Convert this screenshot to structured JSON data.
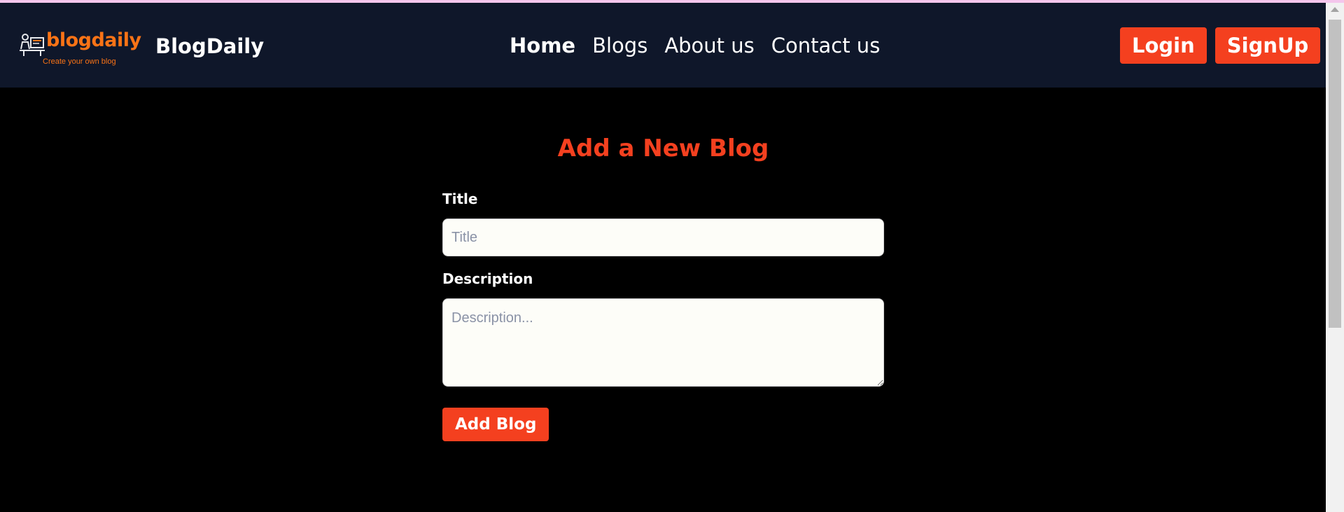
{
  "navbar": {
    "logo_word": "blogdaily",
    "logo_tagline": "Create your own blog",
    "brand": "BlogDaily",
    "links": [
      {
        "label": "Home"
      },
      {
        "label": "Blogs"
      },
      {
        "label": "About us"
      },
      {
        "label": "Contact us"
      }
    ],
    "login_label": "Login",
    "signup_label": "SignUp"
  },
  "form": {
    "heading": "Add a New Blog",
    "title_label": "Title",
    "title_value": "",
    "title_placeholder": "Title",
    "description_label": "Description",
    "description_value": "",
    "description_placeholder": "Description...",
    "submit_label": "Add Blog"
  },
  "colors": {
    "navbar_bg": "#0f172a",
    "accent": "#f4401f",
    "logo_orange": "#f97316",
    "page_bg": "#000000"
  },
  "icons": {
    "logo": "blogger-at-desk-icon"
  }
}
